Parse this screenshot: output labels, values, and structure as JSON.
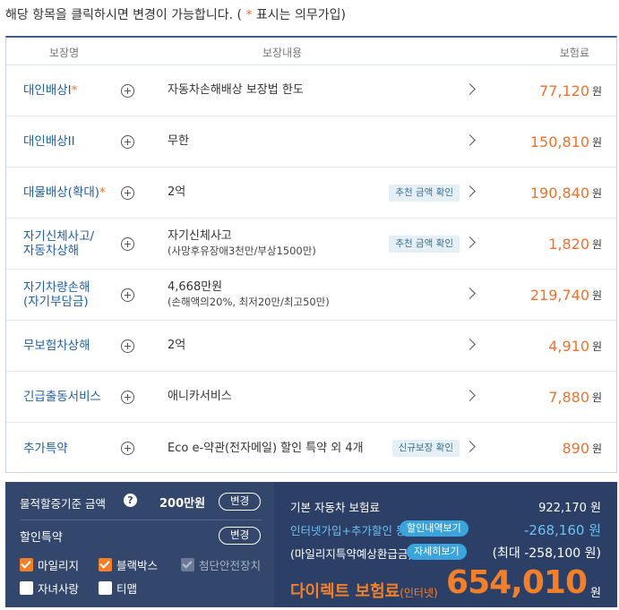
{
  "notice": {
    "text_before": "해당 항목을 클릭하시면 변경이 가능합니다. ( ",
    "star": "*",
    "text_after": " 표시는 의무가입)"
  },
  "table": {
    "headers": {
      "name": "보장명",
      "content": "보장내용",
      "premium": "보험료"
    },
    "currency": "원",
    "rows": [
      {
        "name": "대인배상I",
        "star": "*",
        "desc": "자동차손해배상 보장법 한도",
        "sub": "",
        "badge": "",
        "price": "77,120"
      },
      {
        "name": "대인배상II",
        "star": "",
        "desc": "무한",
        "sub": "",
        "badge": "",
        "price": "150,810"
      },
      {
        "name": "대물배상(확대)",
        "star": "*",
        "desc": "2억",
        "sub": "",
        "badge": "추천 금액 확인",
        "price": "190,840"
      },
      {
        "name": "자기신체사고/\n자동차상해",
        "star": "",
        "desc": "자기신체사고",
        "sub": "(사망후유장애3천만/부상1500만)",
        "badge": "추천 금액 확인",
        "price": "1,820"
      },
      {
        "name": "자기차량손해\n(자기부담금)",
        "star": "",
        "desc": "4,668만원",
        "sub": "(손해액의20%, 최저20만/최고50만)",
        "badge": "",
        "price": "219,740"
      },
      {
        "name": "무보험차상해",
        "star": "",
        "desc": "2억",
        "sub": "",
        "badge": "",
        "price": "4,910"
      },
      {
        "name": "긴급출동서비스",
        "star": "",
        "desc": "애니카서비스",
        "sub": "",
        "badge": "",
        "price": "7,880"
      },
      {
        "name": "추가특약",
        "star": "",
        "desc": "Eco e-약관(전자메일) 할인 특약 외 4개",
        "sub": "",
        "badge": "신규보장 확인",
        "price": "890"
      }
    ]
  },
  "left_panel": {
    "property_label": "물적할증기준 금액",
    "help_icon": "?",
    "property_amount": "200만원",
    "change_label": "변경",
    "discount_label": "할인특약",
    "discount_change_label": "변경",
    "checkboxes": [
      {
        "label": "마일리지",
        "state": "checked"
      },
      {
        "label": "블랙박스",
        "state": "checked"
      },
      {
        "label": "첨단안전장치",
        "state": "disabled"
      },
      {
        "label": "자녀사랑",
        "state": "unchecked"
      },
      {
        "label": "티맵",
        "state": "unchecked"
      }
    ]
  },
  "right_panel": {
    "base_label": "기본 자동차 보험료",
    "base_value": "922,170 원",
    "discount_label": "인터넷가입+추가할인 등",
    "discount_button": "할인내역보기",
    "discount_value": "-268,160 원",
    "mileage_label": "(마일리지특약예상환급금)",
    "mileage_button": "자세히보기",
    "mileage_value": "(최대 -258,100 원)",
    "final_label": "다이렉트 보험료",
    "final_label_small": "(인터넷)",
    "final_price": "654,010",
    "final_won": "원"
  },
  "colors": {
    "accent_orange": "#f2712b",
    "link_blue": "#1f5fa8",
    "panel_navy": "#2c3f66",
    "tag_blue": "#3aa4dd"
  }
}
